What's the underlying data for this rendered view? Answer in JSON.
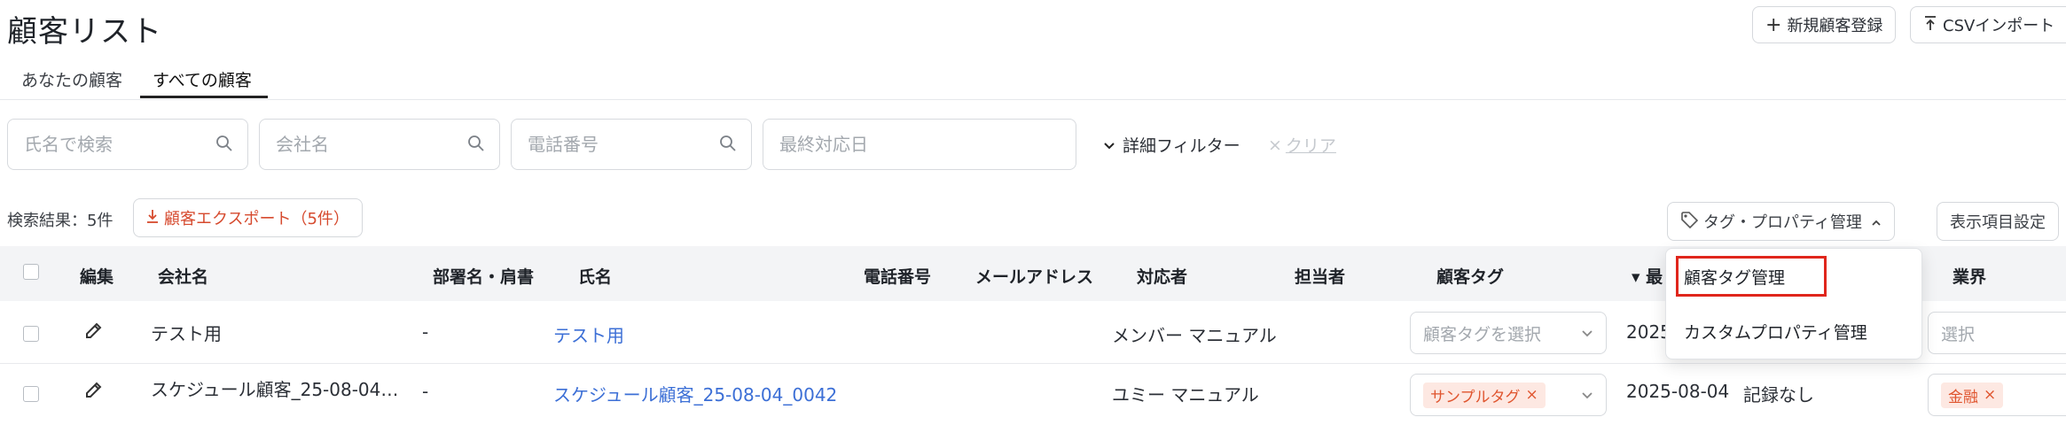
{
  "page": {
    "title": "顧客リスト"
  },
  "header": {
    "new_customer": "新規顧客登録",
    "csv_import": "CSVインポート"
  },
  "tabs": [
    {
      "label": "あなたの顧客"
    },
    {
      "label": "すべての顧客"
    }
  ],
  "filters": {
    "name_placeholder": "氏名で検索",
    "company_placeholder": "会社名",
    "phone_placeholder": "電話番号",
    "last_contact_placeholder": "最終対応日",
    "advanced": "詳細フィルター",
    "clear": "クリア"
  },
  "results": {
    "text": "検索結果：5件",
    "export": "顧客エクスポート（5件）"
  },
  "toolbar": {
    "tag_property": "タグ・プロパティ管理",
    "display_settings": "表示項目設定"
  },
  "table": {
    "headers": {
      "edit": "編集",
      "company": "会社名",
      "department": "部署名・肩書",
      "name": "氏名",
      "phone": "電話番号",
      "email": "メールアドレス",
      "handler": "対応者",
      "owner": "担当者",
      "customer_tag": "顧客タグ",
      "sort_partial": "最",
      "industry": "業界"
    },
    "rows": [
      {
        "company": "テスト用",
        "department": "-",
        "name": "テスト用",
        "handler": "メンバー マニュアル",
        "tag_placeholder": "顧客タグを選択",
        "date": "2025",
        "industry_placeholder": "選択"
      },
      {
        "company": "スケジュール顧客_25-08-04…",
        "department": "-",
        "name": "スケジュール顧客_25-08-04_0042",
        "handler": "ユミー マニュアル",
        "tag": "サンプルタグ",
        "date": "2025-08-04",
        "record": "記録なし",
        "industry": "金融"
      }
    ]
  },
  "dropdown": {
    "items": [
      {
        "label": "顧客タグ管理"
      },
      {
        "label": "カスタムプロパティ管理"
      }
    ]
  },
  "colors": {
    "accent": "#3c6fd6",
    "export": "#d64a2e",
    "highlight": "#e0261c",
    "tag_bg": "#fde8e2"
  }
}
